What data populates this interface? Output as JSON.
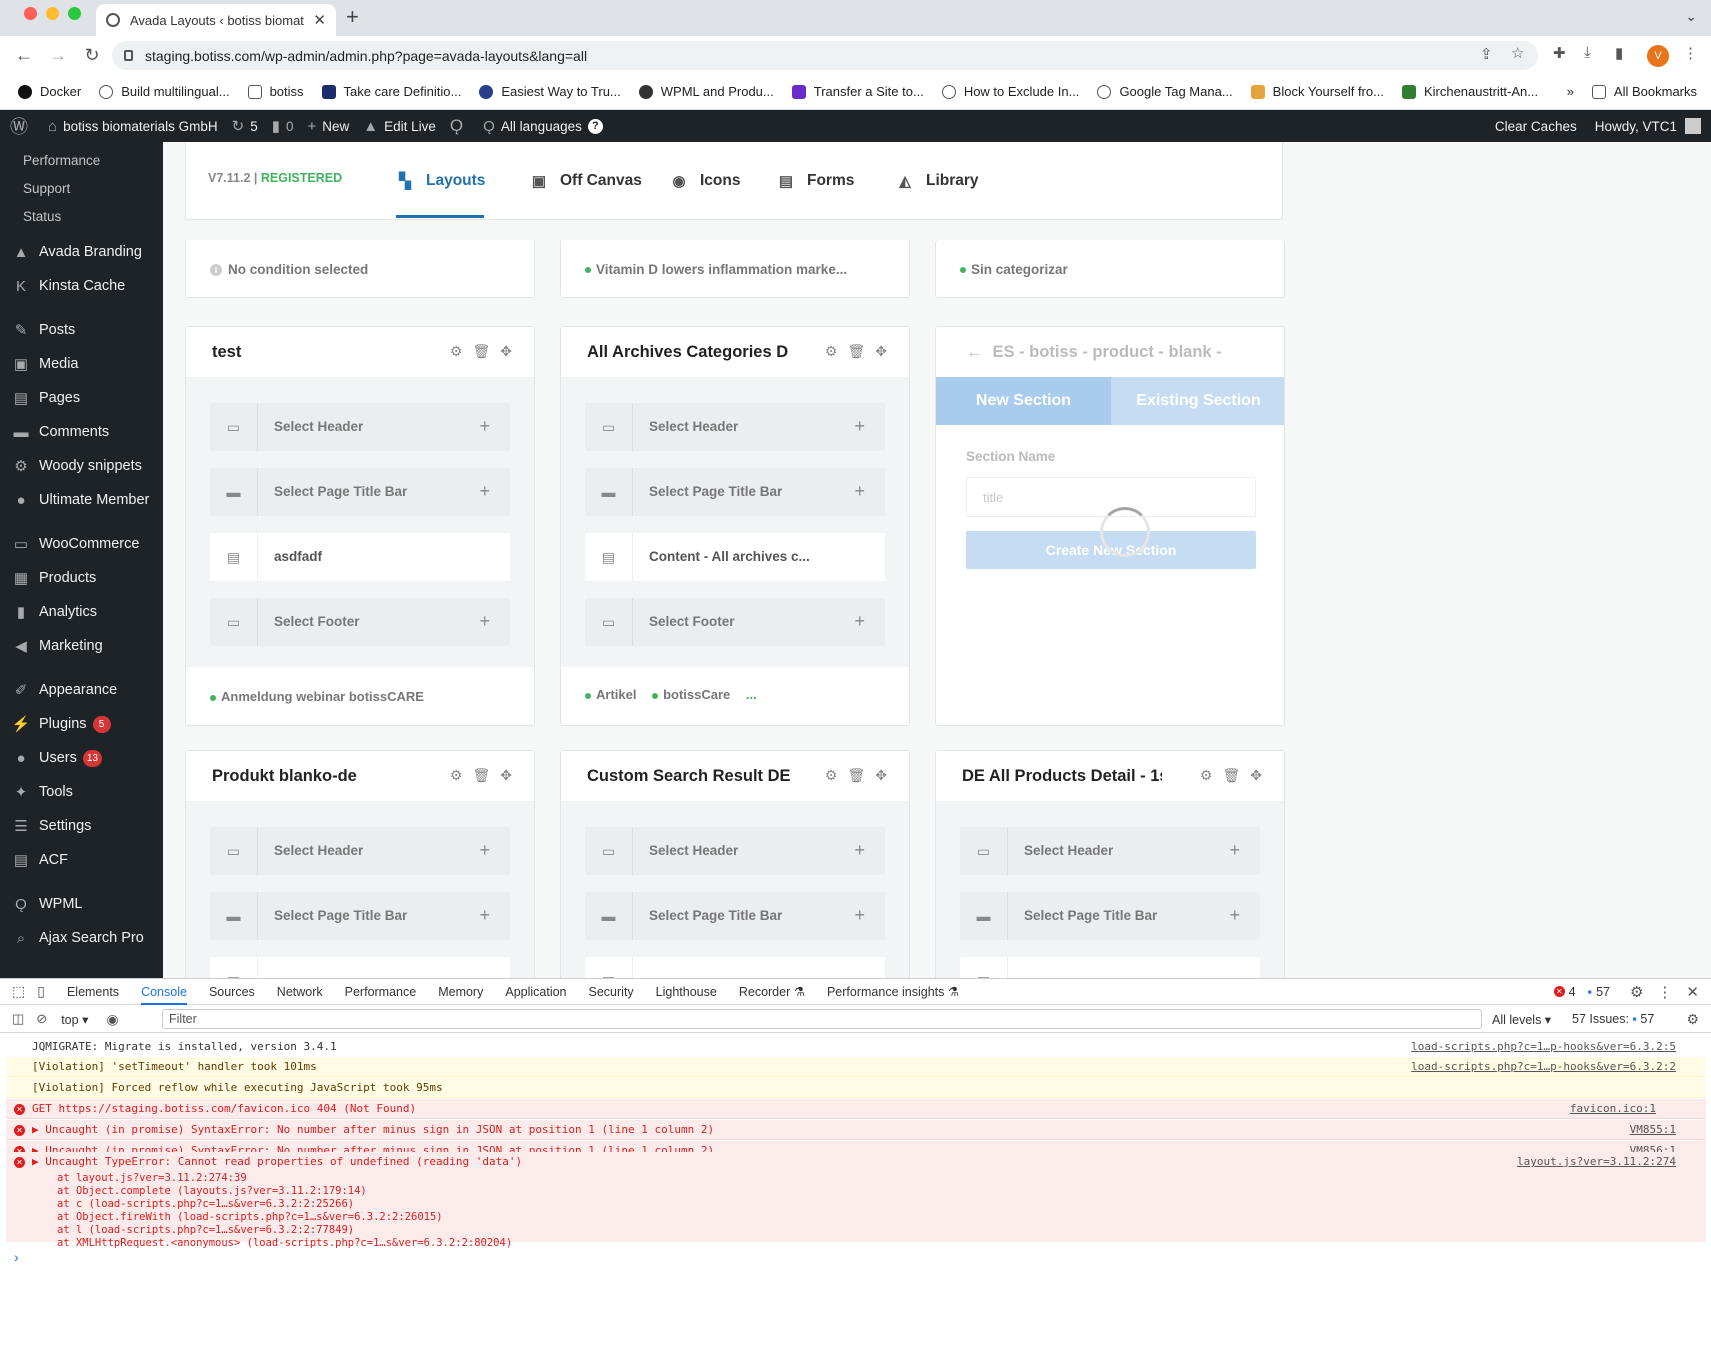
{
  "browser": {
    "tab_title": "Avada Layouts ‹ botiss biomat",
    "url": "staging.botiss.com/wp-admin/admin.php?page=avada-layouts&lang=all",
    "avatar_letter": "V",
    "bookmarks": [
      "Docker",
      "Build multilingual...",
      "botiss",
      "Take care Definitio...",
      "Easiest Way to Tru...",
      "WPML and Produ...",
      "Transfer a Site to...",
      "How to Exclude In...",
      "Google Tag Mana...",
      "Block Yourself fro...",
      "Kirchenaustritt-An..."
    ],
    "more_bookmarks": "»",
    "all_bookmarks": "All Bookmarks"
  },
  "adminbar": {
    "site_name": "botiss biomaterials GmbH",
    "updates_count": "5",
    "comments_count": "0",
    "new_label": "New",
    "edit_live": "Edit Live",
    "all_languages": "All languages",
    "clear_caches": "Clear Caches",
    "howdy": "Howdy, VTC1"
  },
  "sidebar": {
    "submenu": [
      "Performance",
      "Support",
      "Status"
    ],
    "items": [
      {
        "label": "Avada Branding",
        "icon": "avada-icon"
      },
      {
        "label": "Kinsta Cache",
        "icon": "kinsta-icon"
      },
      {
        "label": "Posts",
        "icon": "pin-icon"
      },
      {
        "label": "Media",
        "icon": "media-icon"
      },
      {
        "label": "Pages",
        "icon": "pages-icon"
      },
      {
        "label": "Comments",
        "icon": "comment-icon"
      },
      {
        "label": "Woody snippets",
        "icon": "gear-icon"
      },
      {
        "label": "Ultimate Member",
        "icon": "user-icon"
      },
      {
        "label": "WooCommerce",
        "icon": "woo-icon"
      },
      {
        "label": "Products",
        "icon": "products-icon"
      },
      {
        "label": "Analytics",
        "icon": "chart-icon"
      },
      {
        "label": "Marketing",
        "icon": "megaphone-icon"
      },
      {
        "label": "Appearance",
        "icon": "brush-icon"
      },
      {
        "label": "Plugins",
        "icon": "plugin-icon",
        "badge": "5"
      },
      {
        "label": "Users",
        "icon": "user-icon",
        "badge": "13"
      },
      {
        "label": "Tools",
        "icon": "wrench-icon"
      },
      {
        "label": "Settings",
        "icon": "settings-icon"
      },
      {
        "label": "ACF",
        "icon": "acf-icon"
      },
      {
        "label": "WPML",
        "icon": "wpml-icon"
      },
      {
        "label": "Ajax Search Pro",
        "icon": "search-icon"
      }
    ]
  },
  "avada": {
    "version": "V7.11.2",
    "separator": "|",
    "registered": "REGISTERED",
    "tabs": [
      {
        "label": "Layouts",
        "icon": "layouts-icon"
      },
      {
        "label": "Off Canvas",
        "icon": "off-canvas-icon"
      },
      {
        "label": "Icons",
        "icon": "icons-icon"
      },
      {
        "label": "Forms",
        "icon": "forms-icon"
      },
      {
        "label": "Library",
        "icon": "library-icon"
      }
    ]
  },
  "top_cards": [
    {
      "condition": "No condition selected"
    },
    {
      "condition": "Vitamin D lowers inflammation marke..."
    },
    {
      "condition": "Sin categorizar"
    }
  ],
  "cards": [
    {
      "title": "test",
      "slots": [
        "Select Header",
        "Select Page Title Bar",
        "asdfadf",
        "Select Footer"
      ],
      "conditions": [
        "Anmeldung webinar botissCARE"
      ]
    },
    {
      "title": "All Archives Categories D",
      "slots": [
        "Select Header",
        "Select Page Title Bar",
        "Content - All archives c...",
        "Select Footer"
      ],
      "conditions": [
        "Artikel",
        "botissCare"
      ],
      "more": "..."
    },
    {
      "title": "Produkt blanko-de",
      "slots": [
        "Select Header",
        "Select Page Title Bar"
      ]
    },
    {
      "title": "Custom Search Result DE",
      "slots": [
        "Select Header",
        "Select Page Title Bar"
      ]
    },
    {
      "title": "DE All Products Detail - 1s",
      "slots": [
        "Select Header",
        "Select Page Title Bar"
      ]
    }
  ],
  "new_section_panel": {
    "title": "ES - botiss - product - blank -",
    "tab_new": "New Section",
    "tab_existing": "Existing Section",
    "name_label": "Section Name",
    "name_placeholder": "title",
    "create_button": "Create New Section"
  },
  "devtools": {
    "tabs": [
      "Elements",
      "Console",
      "Sources",
      "Network",
      "Performance",
      "Memory",
      "Application",
      "Security",
      "Lighthouse",
      "Recorder",
      "Performance insights"
    ],
    "error_count": "4",
    "issue_count": "57",
    "context": "top",
    "filter_placeholder": "Filter",
    "levels": "All levels",
    "issues_label": "57 Issues:",
    "issues_count": "57",
    "logs": [
      {
        "type": "info",
        "msg": "JQMIGRATE: Migrate is installed, version 3.4.1",
        "src": "load-scripts.php?c=1…p-hooks&ver=6.3.2:5"
      },
      {
        "type": "warn",
        "msg": "[Violation] 'setTimeout' handler took 101ms",
        "src": "load-scripts.php?c=1…p-hooks&ver=6.3.2:2"
      },
      {
        "type": "warn",
        "msg": "[Violation] Forced reflow while executing JavaScript took 95ms",
        "src": ""
      },
      {
        "type": "err",
        "msg": "GET https://staging.botiss.com/favicon.ico 404 (Not Found)",
        "src": "favicon.ico:1"
      },
      {
        "type": "err",
        "msg": "▶ Uncaught (in promise) SyntaxError: No number after minus sign in JSON at position 1 (line 1 column 2)",
        "src": "VM855:1"
      },
      {
        "type": "err",
        "msg": "▶ Uncaught (in promise) SyntaxError: No number after minus sign in JSON at position 1 (line 1 column 2)",
        "src": "VM856:1"
      },
      {
        "type": "err",
        "msg": "▶ Uncaught TypeError: Cannot read properties of undefined (reading 'data')",
        "src": "layout.js?ver=3.11.2:274"
      }
    ],
    "stack": [
      "at layout.js?ver=3.11.2:274:39",
      "at Object.complete (layouts.js?ver=3.11.2:179:14)",
      "at c (load-scripts.php?c=1…s&ver=6.3.2:2:25266)",
      "at Object.fireWith (load-scripts.php?c=1…s&ver=6.3.2:2:26015)",
      "at l (load-scripts.php?c=1…s&ver=6.3.2:2:77849)",
      "at XMLHttpRequest.<anonymous> (load-scripts.php?c=1…s&ver=6.3.2:2:80204)"
    ],
    "prompt": "›"
  }
}
